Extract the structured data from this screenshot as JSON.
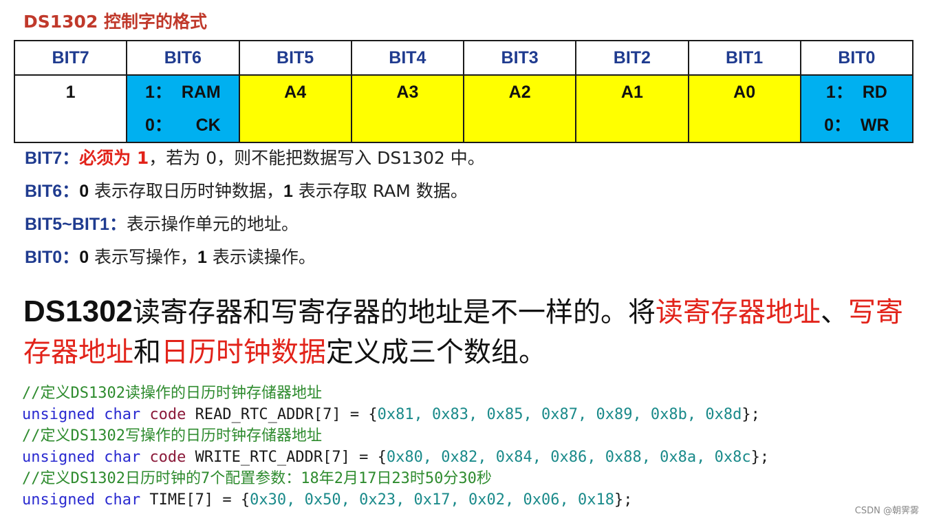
{
  "title": "DS1302 控制字的格式",
  "table": {
    "headers": [
      "BIT7",
      "BIT6",
      "BIT5",
      "BIT4",
      "BIT3",
      "BIT2",
      "BIT1",
      "BIT0"
    ],
    "cells": [
      {
        "lines": [
          "1"
        ],
        "color": "white"
      },
      {
        "lines": [
          "1：  RAM",
          "0：     CK"
        ],
        "color": "#00b0f0"
      },
      {
        "lines": [
          "A4"
        ],
        "color": "#ffff00"
      },
      {
        "lines": [
          "A3"
        ],
        "color": "#ffff00"
      },
      {
        "lines": [
          "A2"
        ],
        "color": "#ffff00"
      },
      {
        "lines": [
          "A1"
        ],
        "color": "#ffff00"
      },
      {
        "lines": [
          "A0"
        ],
        "color": "#ffff00"
      },
      {
        "lines": [
          "1：  RD",
          "0：  WR"
        ],
        "color": "#00b0f0"
      }
    ]
  },
  "notes": {
    "n1": {
      "label": "BIT7：",
      "emph": "必须为 1",
      "rest": "，若为 0，则不能把数据写入 DS1302 中。"
    },
    "n2": {
      "label": "BIT6：",
      "v0": "0",
      "t0": " 表示存取日历时钟数据，",
      "v1": "1",
      "t1": " 表示存取 RAM 数据。"
    },
    "n3": {
      "label": "BIT5~BIT1：",
      "text": "表示操作单元的地址。"
    },
    "n4": {
      "label": "BIT0：",
      "v0": "0",
      "t0": " 表示写操作，",
      "v1": "1",
      "t1": " 表示读操作。"
    }
  },
  "statement": {
    "p1": "DS1302",
    "p2": "读寄存器和写寄存器的地址是不一样的。将",
    "r1": "读寄存器地址",
    "p3": "、",
    "r2": "写寄存器地址",
    "p4": "和",
    "r3": "日历时钟数据",
    "p5": "定义成三个数组。"
  },
  "code": {
    "c1": "//定义DS1302读操作的日历时钟存储器地址",
    "l1": {
      "kw": "unsigned char",
      "kw2": "code",
      "name": " READ_RTC_ADDR[7] = {",
      "vals": "0x81, 0x83, 0x85, 0x87, 0x89, 0x8b, 0x8d",
      "end": "};"
    },
    "c2": "//定义DS1302写操作的日历时钟存储器地址",
    "l2": {
      "kw": "unsigned char",
      "kw2": "code",
      "name": " WRITE_RTC_ADDR[7] = {",
      "vals": "0x80, 0x82, 0x84, 0x86, 0x88, 0x8a, 0x8c",
      "end": "};"
    },
    "c3": "//定义DS1302日历时钟的7个配置参数：18年2月17日23时50分30秒",
    "l3": {
      "kw": "unsigned char",
      "name": " TIME[7] = {",
      "vals": "0x30, 0x50, 0x23, 0x17, 0x02, 0x06, 0x18",
      "end": "};"
    }
  },
  "watermark": "CSDN @朝霁雾"
}
